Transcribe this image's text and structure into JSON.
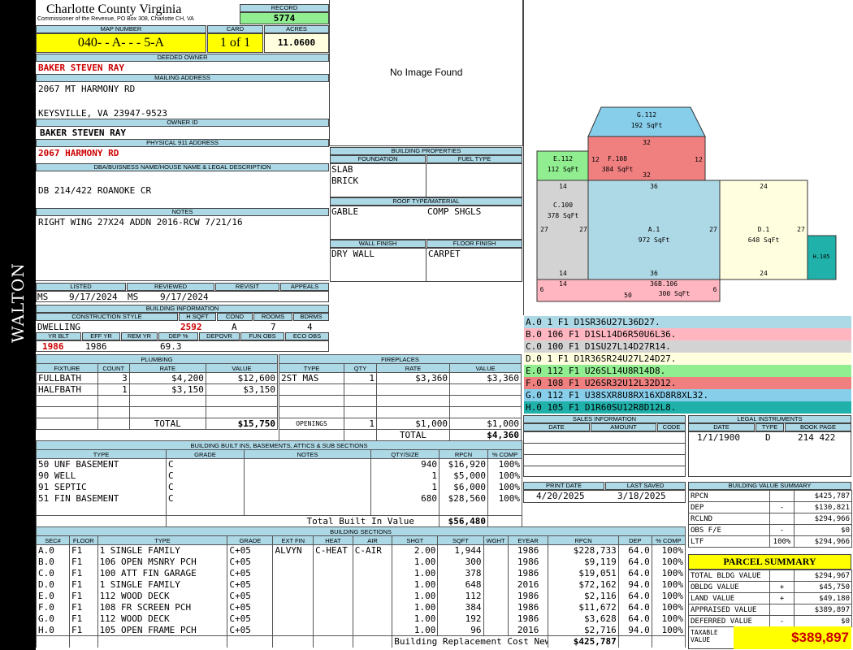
{
  "side_label": "WALTON",
  "header": {
    "county": "Charlotte County Virginia",
    "commissioner": "Commissioner of the Revenue, PO Box 308, Charlotte CH, VA",
    "record_label": "RECORD",
    "record": "5774",
    "map_label": "MAP NUMBER",
    "map_number": "040- - A- - - 5-A",
    "card_label": "CARD",
    "card": "1 of 1",
    "acres_label": "ACRES",
    "acres": "11.0600"
  },
  "owner": {
    "deeded_label": "DEEDED OWNER",
    "deeded": "BAKER STEVEN RAY",
    "mailing_label": "MAILING ADDRESS",
    "mail1": "2067 MT HARMONY RD",
    "mail2": "KEYSVILLE, VA 23947-9523",
    "ownerid_label": "OWNER ID",
    "ownerid": "BAKER STEVEN RAY",
    "phys_label": "PHYSICAL 911 ADDRESS",
    "phys": "2067 HARMONY RD",
    "dba_label": "DBA/BUISNESS NAME/HOUSE NAME & LEGAL DESCRIPTION",
    "dba": "DB 214/422 ROANOKE CR",
    "notes_label": "NOTES",
    "notes": "RIGHT WING 27X24 ADDN 2016-RCW 7/21/16"
  },
  "image_text": "No Image Found",
  "bldg_props": {
    "title": "BUILDING PROPERTIES",
    "foundation_label": "FOUNDATION",
    "fuel_label": "FUEL TYPE",
    "found1": "SLAB",
    "found2": "BRICK",
    "roof_label": "ROOF TYPE/MATERIAL",
    "roof1": "GABLE",
    "roof2": "COMP SHGLS",
    "wall_label": "WALL FINISH",
    "floor_label": "FLOOR FINISH",
    "wall": "DRY WALL",
    "floor": "CARPET"
  },
  "review": {
    "listed_label": "LISTED",
    "reviewed_label": "REVIEWED",
    "revisit_label": "REVISIT",
    "appeals_label": "APPEALS",
    "listed_by": "MS",
    "listed": "9/17/2024",
    "reviewed_by": "MS",
    "reviewed": "9/17/2024"
  },
  "bldg_info": {
    "title": "BUILDING INFORMATION",
    "cs_label": "CONSTRUCTION STYLE",
    "hsqft_label": "H SQFT",
    "cond_label": "COND",
    "rooms_label": "ROOMS",
    "bdrms_label": "BDRMS",
    "style": "DWELLING",
    "hsqft": "2592",
    "cond": "A",
    "rooms": "7",
    "bdrms": "4",
    "yrblt_label": "YR BLT",
    "effyr_label": "EFF YR",
    "remyr_label": "REM YR",
    "dep_label": "DEP %",
    "depovr_label": "DEPOVR",
    "funobs_label": "FUN OBS",
    "ecoobs_label": "ECO OBS",
    "yrblt": "1986",
    "effyr": "1986",
    "dep": "69.3"
  },
  "plumbing": {
    "title": "PLUMBING",
    "h": [
      "FIXTURE",
      "COUNT",
      "RATE",
      "VALUE"
    ],
    "rows": [
      [
        "FULLBATH",
        "3",
        "$4,200",
        "$12,600"
      ],
      [
        "HALFBATH",
        "1",
        "$3,150",
        "$3,150"
      ]
    ],
    "total_label": "TOTAL",
    "total": "$15,750"
  },
  "fireplaces": {
    "title": "FIREPLACES",
    "h": [
      "TYPE",
      "QTY",
      "RATE",
      "VALUE"
    ],
    "rows": [
      [
        "2ST MAS",
        "1",
        "$3,360",
        "$3,360"
      ]
    ],
    "openings_label": "OPENINGS",
    "openings": [
      "1",
      "$1,000",
      "$1,000"
    ],
    "total_label": "TOTAL",
    "total": "$4,360"
  },
  "builtins": {
    "title": "BUILDING BUILT INS, BASEMENTS, ATTICS & SUB SECTIONS",
    "h": [
      "TYPE",
      "GRADE",
      "NOTES",
      "QTY/SIZE",
      "RPCN",
      "% COMP"
    ],
    "rows": [
      [
        "50 UNF BASEMENT",
        "C",
        "",
        "940",
        "$16,920",
        "100%"
      ],
      [
        "90 WELL",
        "C",
        "",
        "1",
        "$5,000",
        "100%"
      ],
      [
        "91 SEPTIC",
        "C",
        "",
        "1",
        "$6,000",
        "100%"
      ],
      [
        "51 FIN BASEMENT",
        "C",
        "",
        "680",
        "$28,560",
        "100%"
      ]
    ],
    "total_label": "Total Built In Value",
    "total": "$56,480"
  },
  "sections": {
    "title": "BUILDING SECTIONS",
    "h": [
      "SEC#",
      "FLOOR",
      "TYPE",
      "GRADE",
      "EXT FIN",
      "HEAT",
      "AIR",
      "SHGT",
      "SQFT",
      "WGHT",
      "EYEAR",
      "RPCN",
      "DEP",
      "% COMP"
    ],
    "rows": [
      [
        "A.0",
        "F1",
        "1 SINGLE FAMILY",
        "C+05",
        "ALVYN",
        "C-HEAT",
        "C-AIR",
        "2.00",
        "1,944",
        "",
        "1986",
        "$228,733",
        "64.0",
        "100%"
      ],
      [
        "B.0",
        "F1",
        "106 OPEN MSNRY PCH",
        "C+05",
        "",
        "",
        "",
        "1.00",
        "300",
        "",
        "1986",
        "$9,119",
        "64.0",
        "100%"
      ],
      [
        "C.0",
        "F1",
        "100 ATT FIN GARAGE",
        "C+05",
        "",
        "",
        "",
        "1.00",
        "378",
        "",
        "1986",
        "$19,051",
        "64.0",
        "100%"
      ],
      [
        "D.0",
        "F1",
        "1 SINGLE FAMILY",
        "C+05",
        "",
        "",
        "",
        "1.00",
        "648",
        "",
        "2016",
        "$72,162",
        "94.0",
        "100%"
      ],
      [
        "E.0",
        "F1",
        "112 WOOD DECK",
        "C+05",
        "",
        "",
        "",
        "1.00",
        "112",
        "",
        "1986",
        "$2,116",
        "64.0",
        "100%"
      ],
      [
        "F.0",
        "F1",
        "108 FR SCREEN PCH",
        "C+05",
        "",
        "",
        "",
        "1.00",
        "384",
        "",
        "1986",
        "$11,672",
        "64.0",
        "100%"
      ],
      [
        "G.0",
        "F1",
        "112 WOOD DECK",
        "C+05",
        "",
        "",
        "",
        "1.00",
        "192",
        "",
        "1986",
        "$3,628",
        "64.0",
        "100%"
      ],
      [
        "H.0",
        "F1",
        "105 OPEN FRAME PCH",
        "C+05",
        "",
        "",
        "",
        "1.00",
        "96",
        "",
        "2016",
        "$2,716",
        "94.0",
        "100%"
      ]
    ],
    "total_label": "Building Replacement Cost New",
    "total": "$425,787"
  },
  "sketch": {
    "areas": [
      {
        "id": "G.112",
        "sqft": "192 SqFt",
        "color": "#87ceeb"
      },
      {
        "id": "E.112",
        "sqft": "112 SqFt",
        "color": "#90ee90"
      },
      {
        "id": "F.108",
        "sqft": "384 SqFt",
        "color": "#f08080"
      },
      {
        "id": "C.100",
        "sqft": "378 SqFt",
        "color": "#d3d3d3"
      },
      {
        "id": "A.1",
        "sqft": "972 SqFt",
        "color": "#add8e6"
      },
      {
        "id": "D.1",
        "sqft": "648 SqFt",
        "color": "#ffffe0"
      },
      {
        "id": "H.105",
        "sqft": "",
        "color": "#20b2aa"
      },
      {
        "id": "B.106",
        "sqft": "300 SqFt",
        "color": "#ffb6c1"
      }
    ],
    "dims": [
      "32",
      "12",
      "12",
      "32",
      "36",
      "24",
      "14",
      "27",
      "27",
      "27",
      "27",
      "14",
      "36",
      "24",
      "6",
      "14",
      "36",
      "6",
      "50"
    ]
  },
  "traverse": [
    {
      "text": "A.0  1    F1  D1SR36U27L36D27.",
      "color": "#add8e6"
    },
    {
      "text": "B.0  106  F1  D1SL14D6R50U6L36.",
      "color": "#ffb6c1"
    },
    {
      "text": "C.0  100  F1  D1SU27L14D27R14.",
      "color": "#d3d3d3"
    },
    {
      "text": "D.0  1    F1  D1R36SR24U27L24D27.",
      "color": "#ffffe0"
    },
    {
      "text": "E.0  112  F1  U26SL14U8R14D8.",
      "color": "#90ee90"
    },
    {
      "text": "F.0  108  F1  U26SR32U12L32D12.",
      "color": "#f08080"
    },
    {
      "text": "G.0  112  F1  U38SXR8U8RX16XD8R8XL32.",
      "color": "#87ceeb"
    },
    {
      "text": "H.0  105  F1  D1R60SU12R8D12L8.",
      "color": "#20b2aa"
    }
  ],
  "sales": {
    "title": "SALES INFORMATION",
    "h": [
      "DATE",
      "AMOUNT",
      "CODE"
    ]
  },
  "legal": {
    "title": "LEGAL INSTRUMENTS",
    "h": [
      "DATE",
      "TYPE",
      "BOOK PAGE"
    ],
    "row": [
      "1/1/1900",
      "D",
      "214 422"
    ]
  },
  "print": {
    "print_label": "PRINT DATE",
    "saved_label": "LAST SAVED",
    "print": "4/20/2025",
    "saved": "3/18/2025"
  },
  "bvs": {
    "title": "BUILDING VALUE SUMMARY",
    "rows": [
      [
        "RPCN",
        "",
        "$425,787"
      ],
      [
        "DEP",
        "-",
        "$130,821"
      ],
      [
        "RCLND",
        "",
        "$294,966"
      ],
      [
        "OBS F/E",
        "-",
        "$0"
      ],
      [
        "LTF",
        "100%",
        "$294,966"
      ]
    ]
  },
  "parcel": {
    "title": "PARCEL SUMMARY",
    "rows": [
      [
        "TOTAL BLDG VALUE",
        "",
        "$294,967"
      ],
      [
        "OBLDG VALUE",
        "+",
        "$45,750"
      ],
      [
        "LAND VALUE",
        "+",
        "$49,180"
      ],
      [
        "APPRAISED VALUE",
        "",
        "$389,897"
      ],
      [
        "DEFERRED VALUE",
        "-",
        "$0"
      ]
    ],
    "taxable_label": "TAXABLE VALUE",
    "taxable": "$389,897"
  },
  "colors": {
    "label_bg": "#add8e6",
    "yellow": "#ffff00",
    "green": "#90ee90",
    "red": "#c00000"
  }
}
